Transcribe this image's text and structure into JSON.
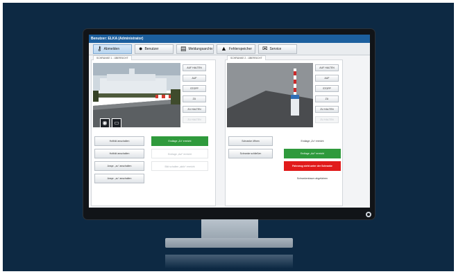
{
  "window": {
    "title": "Benutzer: ELKA (Administrator)"
  },
  "toolbar": {
    "items": [
      {
        "label": "Abmelden",
        "icon": "key-icon"
      },
      {
        "label": "Benutzer",
        "icon": "user-icon"
      },
      {
        "label": "Meldungsarchiv",
        "icon": "archive-icon"
      },
      {
        "label": "Fehlerspeicher",
        "icon": "warning-icon"
      },
      {
        "label": "Service",
        "icon": "mail-icon"
      }
    ]
  },
  "left_panel": {
    "tab": "SCHRANKE 1 - ÜBERSICHT",
    "side_buttons": [
      "AUF HALTEN",
      "AUF",
      "STOPP",
      "ZU",
      "ZU HALTEN",
      "ZU HALTEN"
    ],
    "actions": [
      "Hofbild anschalten",
      "Hofbild anschalten",
      "Anspr. „zu“ anschalten",
      "Anspr. „zu“ anschalten"
    ],
    "statuses": [
      "Endlage „Zu“ erreicht",
      "Endlage „Auf“ erreicht",
      "Bild schalten „aktiv“ erreicht"
    ]
  },
  "right_panel": {
    "tab": "SCHRANKE 2 - ÜBERSICHT",
    "side_buttons": [
      "AUF HALTEN",
      "AUF",
      "STOPP",
      "ZU",
      "ZU HALTEN",
      "ZU HALTEN"
    ],
    "actions": [
      "Schranke öffnen",
      "Schranke schließen"
    ],
    "statuses": [
      "Endlage „Zu“ erreicht",
      "Endlage „Auf“ erreicht",
      "Fahrzeug steht unter der Schranke",
      "Schrankenbaum abgefahren"
    ]
  },
  "colors": {
    "accent": "#1c5f9e",
    "ok": "#2f9a3c",
    "alarm": "#e11b1b",
    "backdrop": "#0d2943"
  }
}
